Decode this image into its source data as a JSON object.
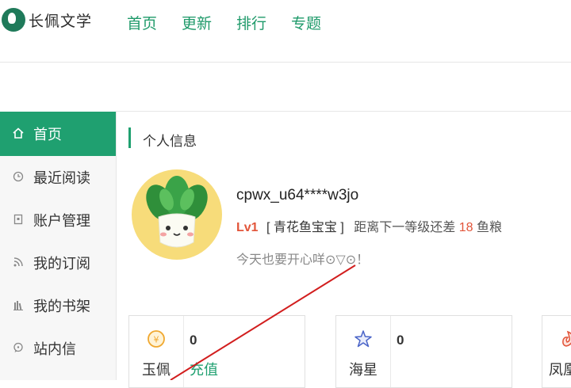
{
  "header": {
    "logo_text": "长佩文学",
    "nav": [
      "首页",
      "更新",
      "排行",
      "专题"
    ]
  },
  "sidebar": {
    "items": [
      {
        "label": "首页",
        "icon": "home-icon",
        "active": true
      },
      {
        "label": "最近阅读",
        "icon": "clock-icon",
        "active": false
      },
      {
        "label": "账户管理",
        "icon": "account-icon",
        "active": false
      },
      {
        "label": "我的订阅",
        "icon": "rss-icon",
        "active": false
      },
      {
        "label": "我的书架",
        "icon": "bookshelf-icon",
        "active": false
      },
      {
        "label": "站内信",
        "icon": "message-icon",
        "active": false
      }
    ]
  },
  "profile": {
    "section_title": "个人信息",
    "username": "cpwx_u64****w3jo",
    "level": "Lv1",
    "level_title": "[ 青花鱼宝宝 ]",
    "next_level_prefix": "距离下一等级还差",
    "next_level_amount": "18",
    "next_level_unit": "鱼粮",
    "motto": "今天也要开心咩⊙▽⊙！"
  },
  "stats": [
    {
      "name": "玉佩",
      "value": "0",
      "action": "充值",
      "icon": "jade-coin-icon"
    },
    {
      "name": "海星",
      "value": "0",
      "icon": "starfish-icon"
    },
    {
      "name": "凤凰",
      "icon": "phoenix-icon"
    }
  ],
  "colors": {
    "accent": "#1fa070",
    "highlight": "#e2553a"
  }
}
